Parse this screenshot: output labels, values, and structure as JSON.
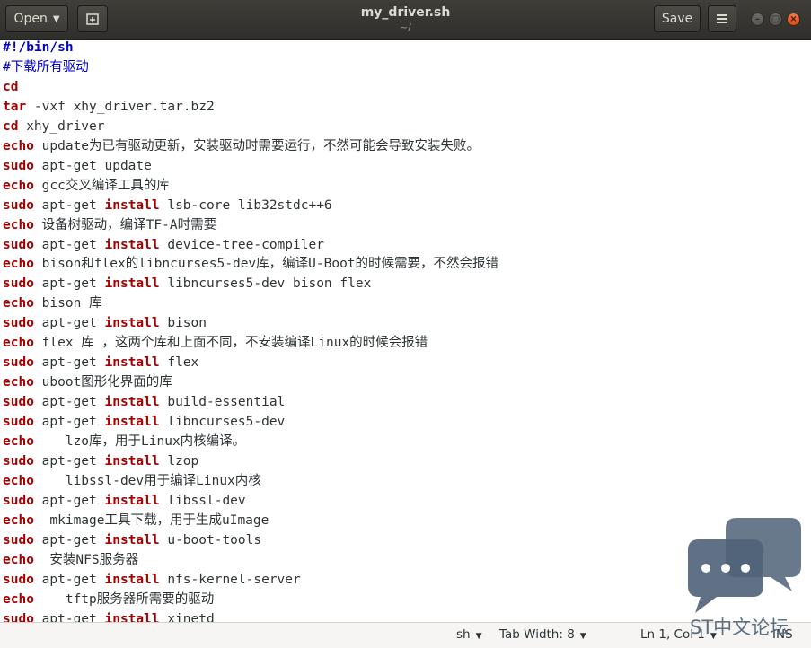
{
  "header": {
    "open_label": "Open",
    "title": "my_driver.sh",
    "subtitle": "~/",
    "save_label": "Save"
  },
  "editor": {
    "lines": [
      [
        {
          "t": "#!/bin/sh",
          "c": "shebang"
        }
      ],
      [
        {
          "t": "#下载所有驱动",
          "c": "cmt"
        }
      ],
      [
        {
          "t": "cd",
          "c": "kw"
        }
      ],
      [
        {
          "t": "tar",
          "c": "kw"
        },
        {
          "t": " -vxf xhy_driver.tar.bz2",
          "c": ""
        }
      ],
      [
        {
          "t": "cd",
          "c": "kw"
        },
        {
          "t": " xhy_driver",
          "c": ""
        }
      ],
      [
        {
          "t": "echo",
          "c": "kw"
        },
        {
          "t": " update为已有驱动更新，安装驱动时需要运行，不然可能会导致安装失败。",
          "c": ""
        }
      ],
      [
        {
          "t": "sudo",
          "c": "kw"
        },
        {
          "t": " apt-get update",
          "c": ""
        }
      ],
      [
        {
          "t": "echo",
          "c": "kw"
        },
        {
          "t": " gcc交叉编译工具的库",
          "c": ""
        }
      ],
      [
        {
          "t": "sudo",
          "c": "kw"
        },
        {
          "t": " apt-get ",
          "c": ""
        },
        {
          "t": "install",
          "c": "kw"
        },
        {
          "t": " lsb-core lib32stdc++6",
          "c": ""
        }
      ],
      [
        {
          "t": "echo",
          "c": "kw"
        },
        {
          "t": " 设备树驱动，编译TF-A时需要",
          "c": ""
        }
      ],
      [
        {
          "t": "sudo",
          "c": "kw"
        },
        {
          "t": " apt-get ",
          "c": ""
        },
        {
          "t": "install",
          "c": "kw"
        },
        {
          "t": " device-tree-compiler",
          "c": ""
        }
      ],
      [
        {
          "t": "echo",
          "c": "kw"
        },
        {
          "t": " bison和flex的libncurses5-dev库，编译U-Boot的时候需要，不然会报错",
          "c": ""
        }
      ],
      [
        {
          "t": "sudo",
          "c": "kw"
        },
        {
          "t": " apt-get ",
          "c": ""
        },
        {
          "t": "install",
          "c": "kw"
        },
        {
          "t": " libncurses5-dev bison flex",
          "c": ""
        }
      ],
      [
        {
          "t": "echo",
          "c": "kw"
        },
        {
          "t": " bison 库",
          "c": ""
        }
      ],
      [
        {
          "t": "sudo",
          "c": "kw"
        },
        {
          "t": " apt-get ",
          "c": ""
        },
        {
          "t": "install",
          "c": "kw"
        },
        {
          "t": " bison",
          "c": ""
        }
      ],
      [
        {
          "t": "echo",
          "c": "kw"
        },
        {
          "t": " flex 库 ，这两个库和上面不同，不安装编译Linux的时候会报错",
          "c": ""
        }
      ],
      [
        {
          "t": "sudo",
          "c": "kw"
        },
        {
          "t": " apt-get ",
          "c": ""
        },
        {
          "t": "install",
          "c": "kw"
        },
        {
          "t": " flex",
          "c": ""
        }
      ],
      [
        {
          "t": "echo",
          "c": "kw"
        },
        {
          "t": " uboot图形化界面的库",
          "c": ""
        }
      ],
      [
        {
          "t": "sudo",
          "c": "kw"
        },
        {
          "t": " apt-get ",
          "c": ""
        },
        {
          "t": "install",
          "c": "kw"
        },
        {
          "t": " build-essential",
          "c": ""
        }
      ],
      [
        {
          "t": "sudo",
          "c": "kw"
        },
        {
          "t": " apt-get ",
          "c": ""
        },
        {
          "t": "install",
          "c": "kw"
        },
        {
          "t": " libncurses5-dev",
          "c": ""
        }
      ],
      [
        {
          "t": "echo",
          "c": "kw"
        },
        {
          "t": "    lzo库，用于Linux内核编译。",
          "c": ""
        }
      ],
      [
        {
          "t": "sudo",
          "c": "kw"
        },
        {
          "t": " apt-get ",
          "c": ""
        },
        {
          "t": "install",
          "c": "kw"
        },
        {
          "t": " lzop",
          "c": ""
        }
      ],
      [
        {
          "t": "echo",
          "c": "kw"
        },
        {
          "t": "    libssl-dev用于编译Linux内核",
          "c": ""
        }
      ],
      [
        {
          "t": "sudo",
          "c": "kw"
        },
        {
          "t": " apt-get ",
          "c": ""
        },
        {
          "t": "install",
          "c": "kw"
        },
        {
          "t": " libssl-dev",
          "c": ""
        }
      ],
      [
        {
          "t": "echo",
          "c": "kw"
        },
        {
          "t": "  mkimage工具下载，用于生成uImage",
          "c": ""
        }
      ],
      [
        {
          "t": "sudo",
          "c": "kw"
        },
        {
          "t": " apt-get ",
          "c": ""
        },
        {
          "t": "install",
          "c": "kw"
        },
        {
          "t": " u-boot-tools",
          "c": ""
        }
      ],
      [
        {
          "t": "echo",
          "c": "kw"
        },
        {
          "t": "  安装NFS服务器",
          "c": ""
        }
      ],
      [
        {
          "t": "sudo",
          "c": "kw"
        },
        {
          "t": " apt-get ",
          "c": ""
        },
        {
          "t": "install",
          "c": "kw"
        },
        {
          "t": " nfs-kernel-server",
          "c": ""
        }
      ],
      [
        {
          "t": "echo",
          "c": "kw"
        },
        {
          "t": "    tftp服务器所需要的驱动",
          "c": ""
        }
      ],
      [
        {
          "t": "sudo",
          "c": "kw"
        },
        {
          "t": " apt-get ",
          "c": ""
        },
        {
          "t": "install",
          "c": "kw"
        },
        {
          "t": " xinetd",
          "c": ""
        }
      ]
    ]
  },
  "statusbar": {
    "language": "sh",
    "tab_width": "Tab Width: 8",
    "position": "Ln 1, Col 1",
    "mode": "INS"
  },
  "watermark": {
    "text": "ST中文论坛"
  },
  "icons": {
    "new_tab": "new-tab-icon",
    "menu": "hamburger-icon",
    "minimize": "minimize-icon",
    "maximize": "maximize-icon",
    "close": "close-icon"
  },
  "colors": {
    "keyword": "#a40000",
    "comment": "#0000c8",
    "close_button": "#e95420"
  }
}
